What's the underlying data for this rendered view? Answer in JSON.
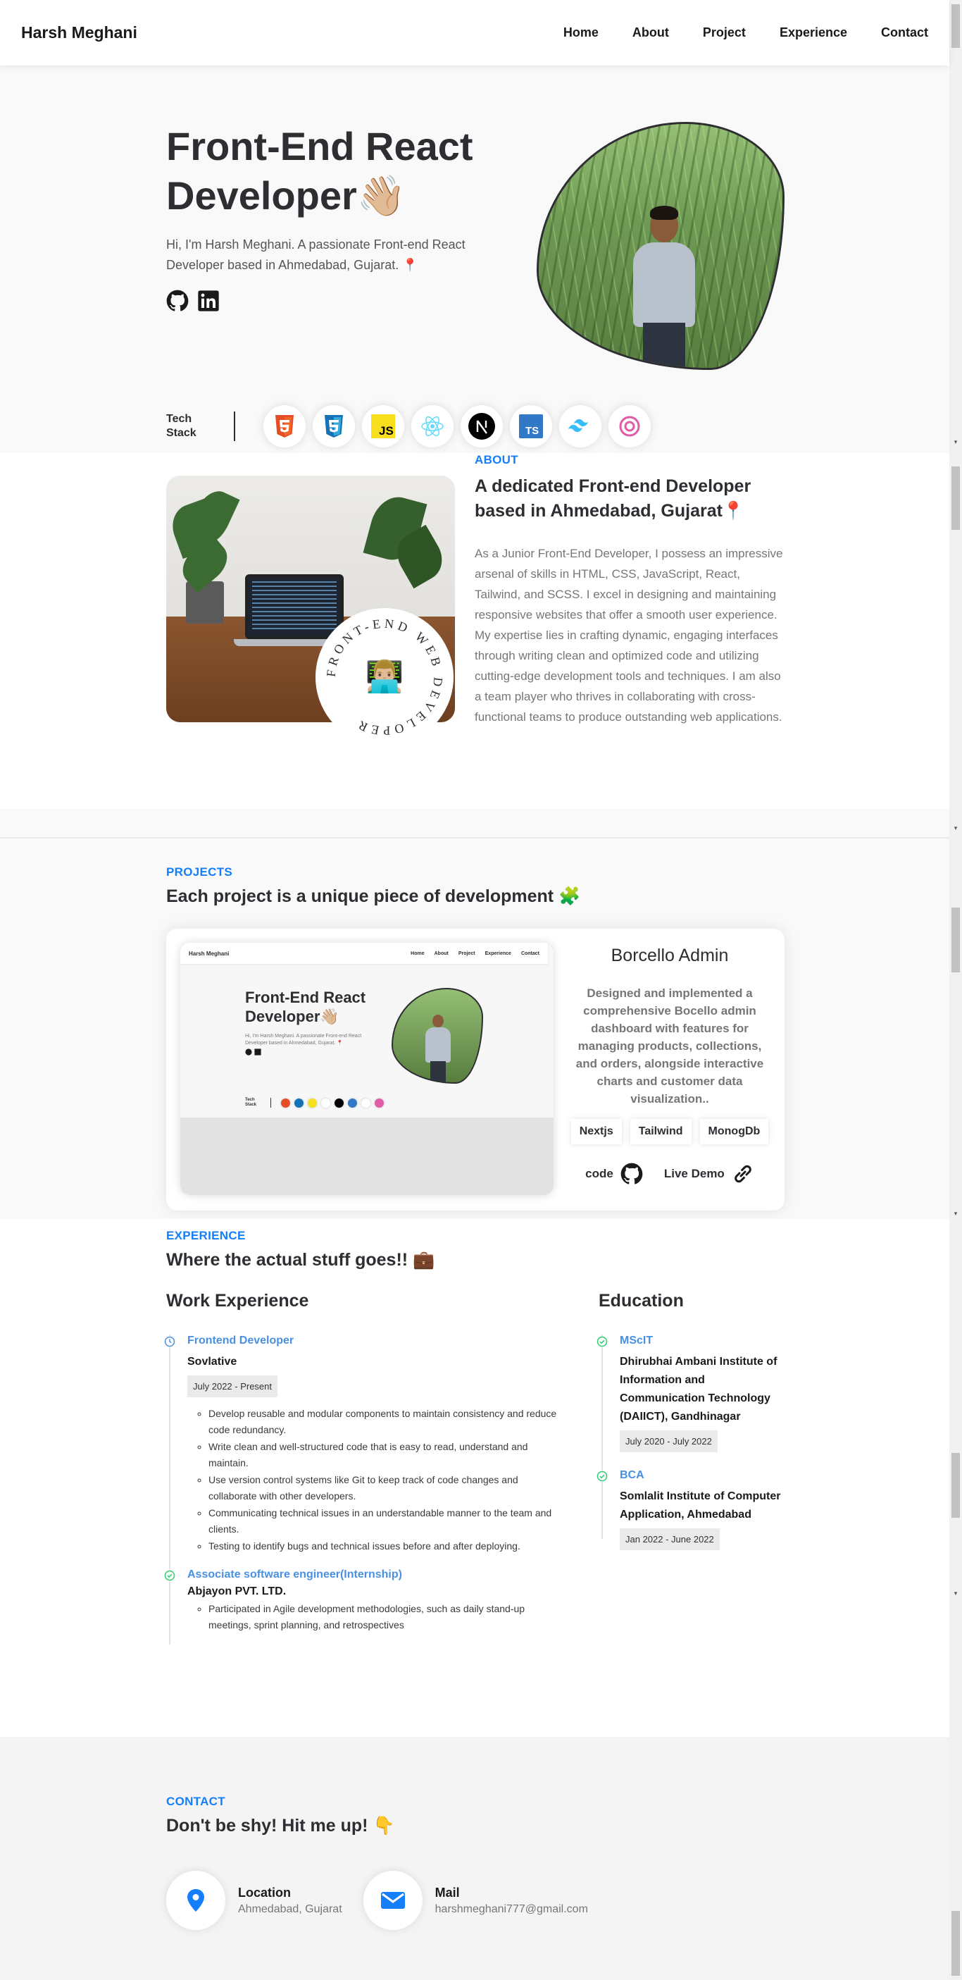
{
  "nav": {
    "brand": "Harsh Meghani",
    "links": [
      "Home",
      "About",
      "Project",
      "Experience",
      "Contact"
    ]
  },
  "hero": {
    "title": "Front-End React Developer👋🏼",
    "subtitle": "Hi, I'm Harsh Meghani. A passionate Front-end React Developer based in Ahmedabad, Gujarat. 📍",
    "socials": [
      "github-icon",
      "linkedin-icon"
    ],
    "tech_stack_label": "Tech Stack",
    "tech_icons": [
      "html5-icon",
      "css3-icon",
      "javascript-icon",
      "react-icon",
      "nextjs-icon",
      "typescript-icon",
      "tailwind-icon",
      "redux-icon"
    ]
  },
  "about": {
    "eyebrow": "ABOUT",
    "title": "A dedicated Front-end Developer based in Ahmedabad, Gujarat📍",
    "body": "As a Junior Front-End Developer, I possess an impressive arsenal of skills in HTML, CSS, JavaScript, React, Tailwind, and SCSS. I excel in designing and maintaining responsive websites that offer a smooth user experience. My expertise lies in crafting dynamic, engaging interfaces through writing clean and optimized code and utilizing cutting-edge development tools and techniques. I am also a team player who thrives in collaborating with cross-functional teams to produce outstanding web applications.",
    "badge_text": "FRONT-END WEB DEVELOPER",
    "badge_emoji": "👨🏼‍💻"
  },
  "projects": {
    "eyebrow": "PROJECTS",
    "title": "Each project is a unique piece of development 🧩",
    "items": [
      {
        "name": "Borcello Admin",
        "description": "Designed and implemented a comprehensive Bocello admin dashboard with features for managing products, collections, and orders, alongside interactive charts and customer data visualization..",
        "tags": [
          "Nextjs",
          "Tailwind",
          "MonogDb"
        ],
        "code_label": "code",
        "demo_label": "Live Demo",
        "preview": {
          "brand": "Harsh Meghani",
          "links": [
            "Home",
            "About",
            "Project",
            "Experience",
            "Contact"
          ],
          "title": "Front-End React Developer👋🏼",
          "subtitle": "Hi, I'm Harsh Meghani. A passionate Front-end React Developer based in Ahmedabad, Gujarat. 📍",
          "tech_stack_label": "Tech Stack"
        }
      }
    ]
  },
  "experience": {
    "eyebrow": "EXPERIENCE",
    "title": "Where the actual stuff goes!! 💼",
    "work_title": "Work Experience",
    "education_title": "Education",
    "work": [
      {
        "role": "Frontend Developer",
        "org": "Sovlative",
        "date": "July 2022 - Present",
        "points": [
          "Develop reusable and modular components to maintain consistency and reduce code redundancy.",
          "Write clean and well-structured code that is easy to read, understand and maintain.",
          "Use version control systems like Git to keep track of code changes and collaborate with other developers.",
          "Communicating technical issues in an understandable manner to the team and clients.",
          "Testing to identify bugs and technical issues before and after deploying."
        ]
      },
      {
        "role": "Associate software engineer(Internship)",
        "org": "Abjayon PVT. LTD.",
        "points": [
          "Participated in Agile development methodologies, such as daily stand-up meetings, sprint planning, and retrospectives"
        ]
      }
    ],
    "education": [
      {
        "degree": "MScIT",
        "school": "Dhirubhai Ambani Institute of Information and Communication Technology (DAIICT), Gandhinagar",
        "date": "July 2020 - July 2022"
      },
      {
        "degree": "BCA",
        "school": "Somlalit Institute of Computer Application, Ahmedabad",
        "date": "Jan 2022 - June 2022"
      }
    ]
  },
  "contact": {
    "eyebrow": "CONTACT",
    "title": "Don't be shy! Hit me up! 👇",
    "items": [
      {
        "icon": "location-pin-icon",
        "title": "Location",
        "value": "Ahmedabad, Gujarat"
      },
      {
        "icon": "mail-icon",
        "title": "Mail",
        "value": "harshmeghani777@gmail.com"
      }
    ]
  },
  "colors": {
    "accent": "#147efb",
    "text": "#2d2e32",
    "muted": "#767676",
    "timeline_work": "#4a90e2",
    "timeline_done": "#2ecc71"
  }
}
